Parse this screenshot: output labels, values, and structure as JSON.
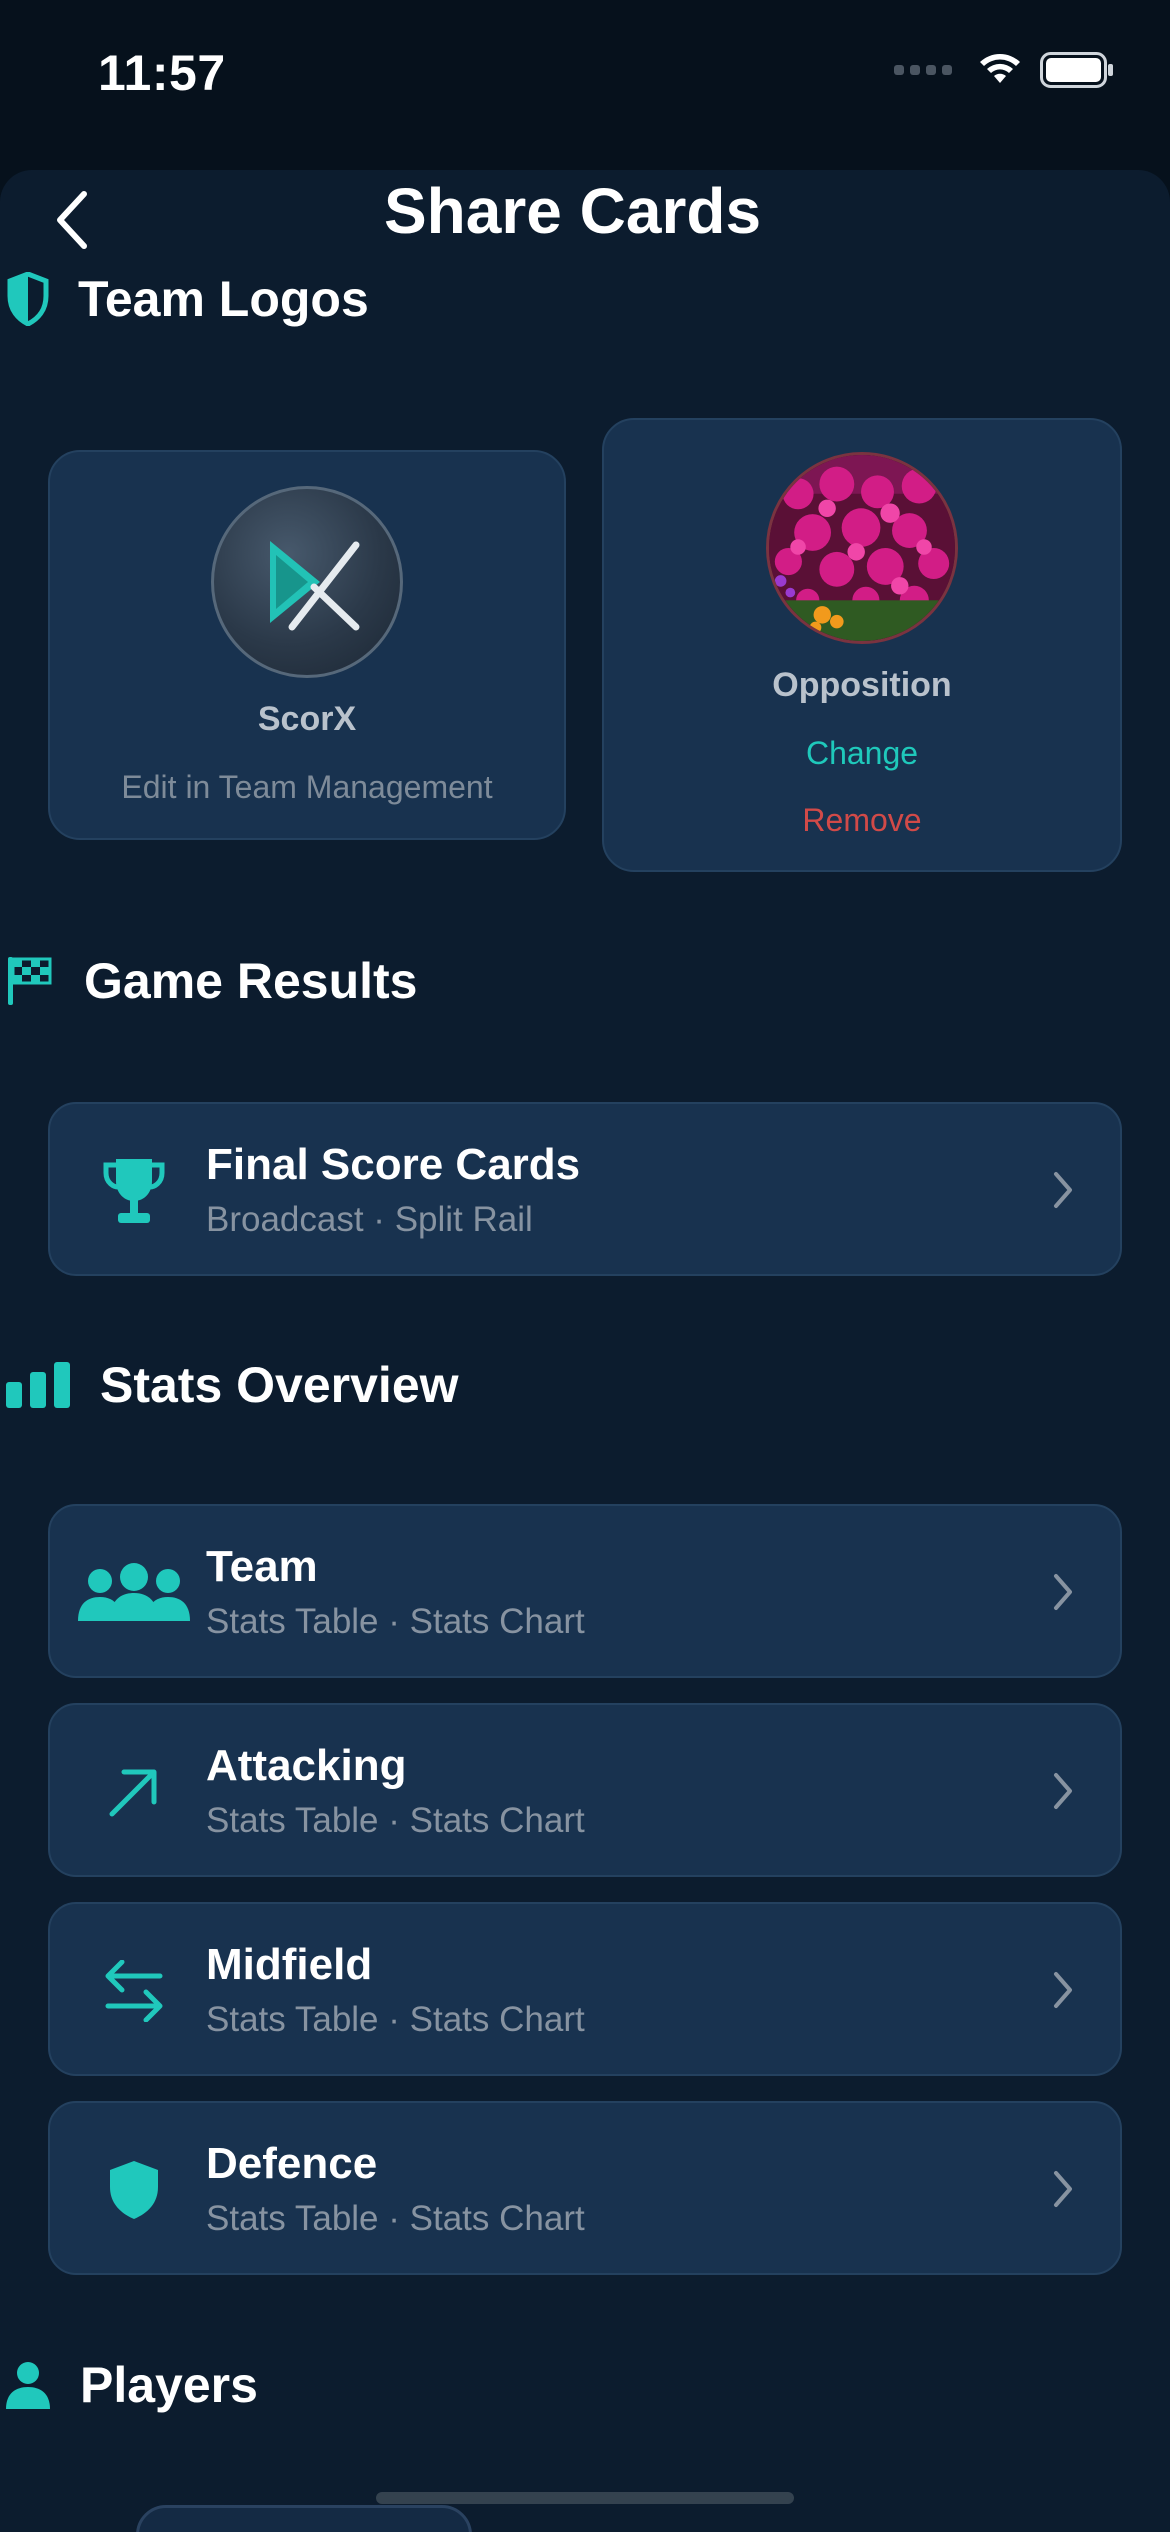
{
  "status_bar": {
    "time": "11:57"
  },
  "nav": {
    "title": "Share Cards"
  },
  "sections": {
    "team_logos": "Team Logos",
    "game_results": "Game Results",
    "stats_overview": "Stats Overview",
    "players": "Players"
  },
  "logos": {
    "home": {
      "name": "ScorX",
      "note": "Edit in Team Management"
    },
    "opposition": {
      "name": "Opposition",
      "change_label": "Change",
      "remove_label": "Remove"
    }
  },
  "game_results": [
    {
      "title": "Final Score Cards",
      "subtitle": "Broadcast · Split Rail",
      "icon": "trophy-icon"
    }
  ],
  "stats": [
    {
      "title": "Team",
      "subtitle": "Stats Table · Stats Chart",
      "icon": "people-icon"
    },
    {
      "title": "Attacking",
      "subtitle": "Stats Table · Stats Chart",
      "icon": "arrow-up-right-icon"
    },
    {
      "title": "Midfield",
      "subtitle": "Stats Table · Stats Chart",
      "icon": "arrows-left-right-icon"
    },
    {
      "title": "Defence",
      "subtitle": "Stats Table · Stats Chart",
      "icon": "shield-icon"
    }
  ],
  "colors": {
    "accent": "#20c8bc",
    "card": "#18324f",
    "background": "#0c1c2e",
    "danger": "#d14a48"
  }
}
